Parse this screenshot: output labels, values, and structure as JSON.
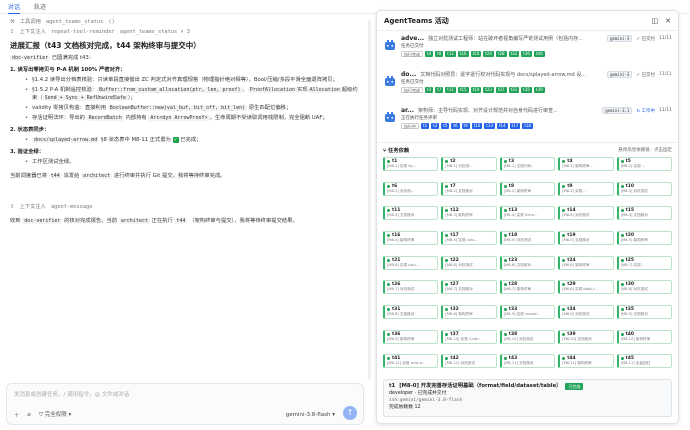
{
  "top_tabs": [
    {
      "label": "对话",
      "active": true
    },
    {
      "label": "轨迹",
      "active": false
    }
  ],
  "chat": {
    "tool1": {
      "icon": "wrench-icon",
      "label": "工具调用",
      "name": "agent_teams_status",
      "args": "()"
    },
    "tool2": {
      "icon": "upload-icon",
      "label": "上下文注入",
      "name": "repeat-tool-reminder",
      "extra": "agent_teams_status × 3"
    },
    "heading": "进展汇报（t43 文档核对完成，t44 架构终审与提交中）",
    "intro_code": "doc-verifier",
    "intro_text": "已圆满完成 t43：",
    "s1_title": "1. 读写出零拷贝与 P-A 机制 100% 严密对齐：",
    "s1_b1": "§1.4.2 读导出分档表核验：只读单段直接借出 ZC 判定式对齐真理规格（物理指针绝对相等），Bool/压缩/多段平滑全面退阵拷贝；",
    "s1_b2_pre": "§1.5.2 P-A 机制遥控核验：",
    "s1_b2_code1": "Buffer::from_custom_allocation(ptr, len, proof)",
    "s1_b2_mid": "、",
    "s1_b2_code2": "ProofAllocation",
    "s1_b2_mid2": "实现",
    "s1_b2_code3": "Allocation",
    "s1_b2_mid3": "超级约束（",
    "s1_b2_code4": "Send + Sync + RefUnwindSafe",
    "s1_b2_end": "）；",
    "s1_b3_pre": "validity 零拷贝构造：直接利用",
    "s1_b3_code": "BooleanBuffer::new(val_buf, bit_off, bit_len)",
    "s1_b3_end": "原生匹配位偏移；",
    "s1_b4_pre": "存活证明法环：导出的",
    "s1_b4_code1": "RecordBatch",
    "s1_b4_mid": "内部持有",
    "s1_b4_code2": "Arc<dyn ArrowProof>",
    "s1_b4_end": "，生命周期不受读取调用栈限制，完全阻断 UAF；",
    "s2_title": "2. 状态表同步：",
    "s2_b1_code": "docs/splayed-arrow.md",
    "s2_b1_mid": "§8 状态表中 M8-11 正式置为",
    "s2_b1_end": "已完成；",
    "s3_title": "3. 验证全绿：",
    "s3_b1": "工作区测试全绿。",
    "outro_pre": "当前调度器已将",
    "outro_code1": "t44",
    "outro_mid": "派发给",
    "outro_code2": "architect",
    "outro_end": "进行终审并执行 Git 提交。我将等待终审完成。",
    "tool3": {
      "icon": "upload-icon",
      "label": "上下文注入",
      "name": "agent-message"
    },
    "msg_pre": "收到",
    "msg_code1": "doc-verifier",
    "msg_mid": "的核对完成报告。当前",
    "msg_code2": "architect",
    "msg_mid2": "正在执行",
    "msg_code3": "t44",
    "msg_end": "（架构终审与提交），我将等待终审提交结果。"
  },
  "composer": {
    "placeholder": "发消息或创建任务，/ 调用指令，@ 文件或对话",
    "icons": [
      "plus-icon",
      "paperclip-icon",
      "shield-icon"
    ],
    "permission_label": "完全权限",
    "model_label": "gemini-3.8-flash",
    "send_icon": "arrow-up-icon"
  },
  "panel": {
    "title": "AgentTeams 活动",
    "header_icons": [
      "split-view-icon",
      "close-icon"
    ],
    "agents": [
      {
        "name": "adve...",
        "desc": "独立对抗测试工程师：站在破坏者视角编写严苛测试用例（包括内存...",
        "model": "gemini-3",
        "status": "已交付",
        "status_line": "任务已交付",
        "count": "11/11",
        "label": "执行完成",
        "chips": [
          "t4",
          "t8",
          "t12",
          "t16",
          "t20",
          "t24",
          "t28",
          "t32",
          "t36",
          "t40"
        ],
        "working": false
      },
      {
        "name": "do...",
        "desc": "文档代码对照员：逐字逐行校对代码实现与 docs/splayed-arrow.md 设...",
        "model": "gemini-3",
        "status": "已交付",
        "status_line": "任务已交付",
        "count": "11/11",
        "label": "执行完成",
        "chips": [
          "t3",
          "t7",
          "t11",
          "t15",
          "t19",
          "t23",
          "t27",
          "t31",
          "t35",
          "t39"
        ],
        "working": false
      },
      {
        "name": "ar...",
        "desc": "架构师：主导代码实现、对齐设计规范并对自身代码进行审查...",
        "model": "gemini-3.1",
        "status": "工作中",
        "status_line": "正在执行任务评审",
        "count": "11/11",
        "label": "执行中",
        "chips": [
          "t1",
          "t2",
          "t5",
          "t6",
          "t9",
          "t10",
          "t13",
          "t14",
          "t17",
          "t18"
        ],
        "working": true
      }
    ],
    "tasks_title": "任务依赖",
    "tasks_right": "悬停高亮依赖链 · 点击固定",
    "tasks": [
      {
        "id": "t1",
        "d": "[M8-1] 实现 Sp..."
      },
      {
        "id": "t2",
        "d": "[M8-1] 对抗测..."
      },
      {
        "id": "t3",
        "d": "[M8-1] 文档代码..."
      },
      {
        "id": "t4",
        "d": "[M8-1] 架构终审..."
      },
      {
        "id": "t5",
        "d": "[M8-2] 实现 ..."
      },
      {
        "id": "t6",
        "d": "[M8-2] 对抗测..."
      },
      {
        "id": "t7",
        "d": "[M8-2] 文档核对"
      },
      {
        "id": "t8",
        "d": "[M8-2] 架构终审"
      },
      {
        "id": "t9",
        "d": "[M8-3] 实现..."
      },
      {
        "id": "t10",
        "d": "[M8-3] 对抗测试"
      },
      {
        "id": "t11",
        "d": "[M8-3] 文档核对"
      },
      {
        "id": "t12",
        "d": "[M8-3] 架构终审"
      },
      {
        "id": "t13",
        "d": "[M8-4] 实现 Sche..."
      },
      {
        "id": "t14",
        "d": "[M8-4] 对抗测试"
      },
      {
        "id": "t15",
        "d": "[M8-4] 文档核对"
      },
      {
        "id": "t16",
        "d": "[M8-4] 架构终审"
      },
      {
        "id": "t17",
        "d": "[M8-5] 实现 colu..."
      },
      {
        "id": "t18",
        "d": "[M8-5] 对抗测试"
      },
      {
        "id": "t19",
        "d": "[M8-5] 文档核对"
      },
      {
        "id": "t20",
        "d": "[M8-5] 架构终审"
      },
      {
        "id": "t21",
        "d": "[M8-6] 实现 colu..."
      },
      {
        "id": "t22",
        "d": "[M8-6] 对抗测试"
      },
      {
        "id": "t23",
        "d": "[M8-6] 文档核对"
      },
      {
        "id": "t24",
        "d": "[M8-6] 架构终审"
      },
      {
        "id": "t25",
        "d": "[M8-7] 实现..."
      },
      {
        "id": "t26",
        "d": "[M8-7] 对抗测试"
      },
      {
        "id": "t27",
        "d": "[M8-7] 文档核对"
      },
      {
        "id": "t28",
        "d": "[M8-7] 架构终审"
      },
      {
        "id": "t29",
        "d": "[M8-8] 实现 data_t..."
      },
      {
        "id": "t30",
        "d": "[M8-8] 对抗测试"
      },
      {
        "id": "t31",
        "d": "[M8-8] 文档核对"
      },
      {
        "id": "t32",
        "d": "[M8-8] 架构终审"
      },
      {
        "id": "t33",
        "d": "[M8-9] 实现 record..."
      },
      {
        "id": "t34",
        "d": "[M8-9] 对抗测试"
      },
      {
        "id": "t35",
        "d": "[M8-9] 文档核对"
      },
      {
        "id": "t36",
        "d": "[M8-9] 架构终审"
      },
      {
        "id": "t37",
        "d": "[M8-10] 实现 Colle..."
      },
      {
        "id": "t38",
        "d": "[M8-10] 对抗测试"
      },
      {
        "id": "t39",
        "d": "[M8-10] 文档核对"
      },
      {
        "id": "t40",
        "d": "[M8-10] 架构终审"
      },
      {
        "id": "t41",
        "d": "[M8-11] 实现 zero-p..."
      },
      {
        "id": "t42",
        "d": "[M8-11] 对抗测试"
      },
      {
        "id": "t43",
        "d": "[M8-11] 文档核对"
      },
      {
        "id": "t44",
        "d": "[M8-11] 架构终审"
      },
      {
        "id": "t45",
        "d": "[M8-11] 全量回归"
      }
    ],
    "detail": {
      "id": "t1",
      "title": "[M8-0] 开发完善存活证明基础（format/field/dataset/table）",
      "badge": "已完成",
      "assignee": "developer · 已完成并交付",
      "model": "ssh:gemini/gemini-3.8-flash",
      "note": "完成依赖数 12"
    }
  }
}
